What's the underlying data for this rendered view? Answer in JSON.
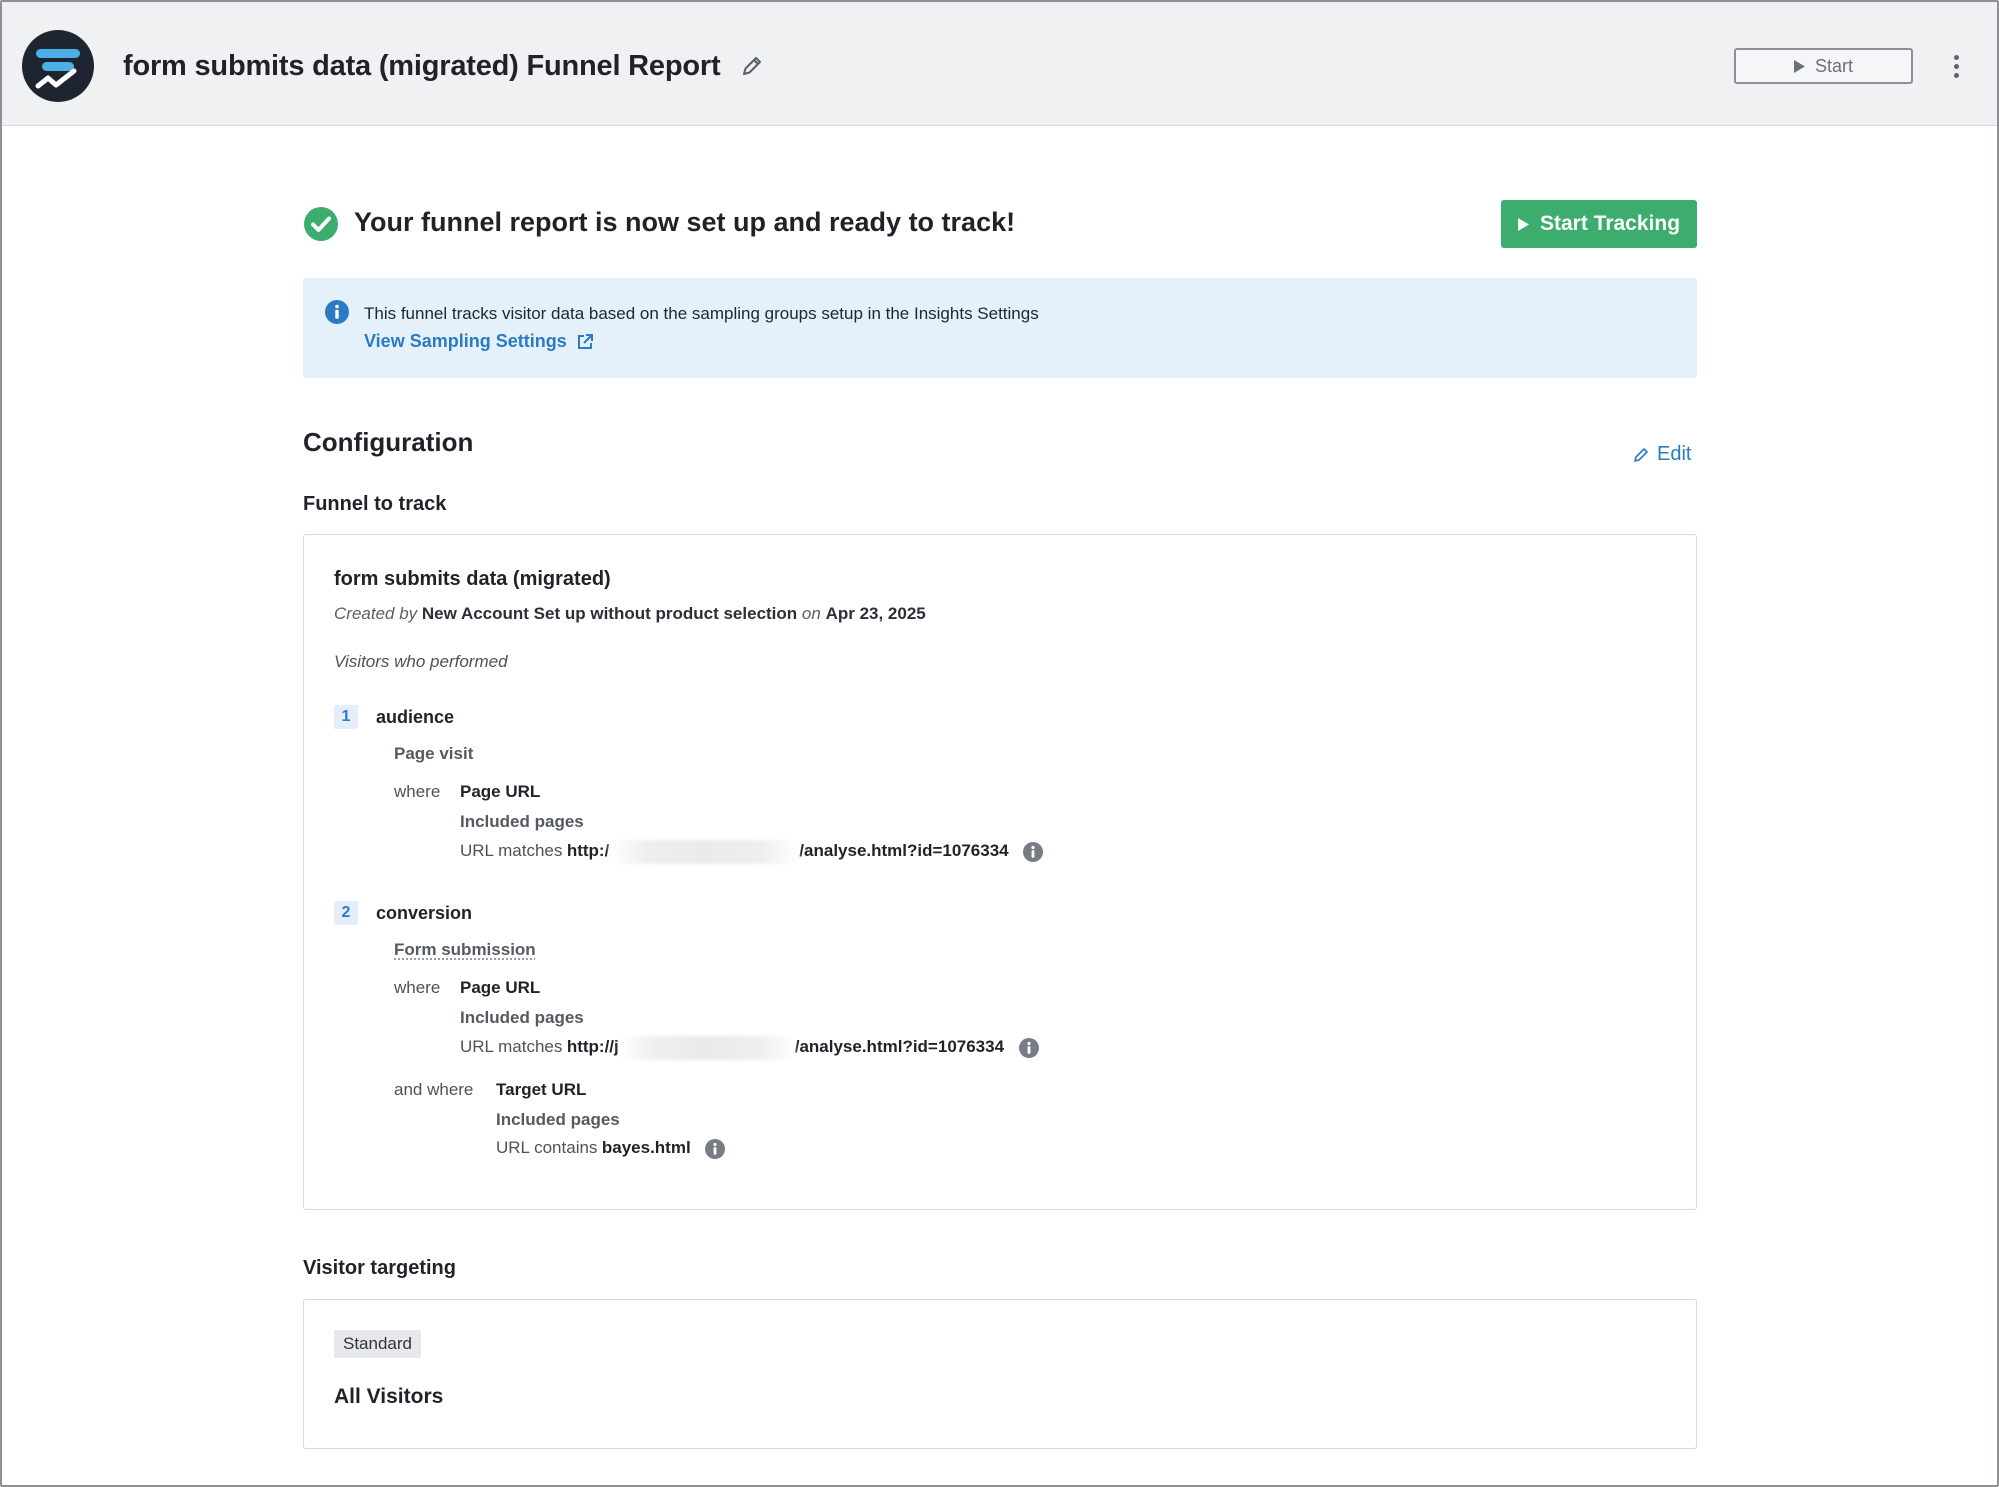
{
  "header": {
    "title": "form submits data (migrated) Funnel Report",
    "start_label": "Start"
  },
  "banner": {
    "title": "Your funnel report is now set up and ready to track!",
    "start_tracking_label": "Start Tracking"
  },
  "info": {
    "text": "This funnel tracks visitor data based on the sampling groups setup in the Insights Settings",
    "link_label": "View Sampling Settings"
  },
  "configuration": {
    "title": "Configuration",
    "edit_label": "Edit",
    "funnel_label": "Funnel to track"
  },
  "funnel": {
    "name": "form submits data (migrated)",
    "created_by_label": "Created by",
    "creator": "New Account Set up without product selection",
    "on_label": "on",
    "date": "Apr 23, 2025",
    "visitors_label": "Visitors who performed",
    "steps": [
      {
        "number": "1",
        "name": "audience",
        "event": "Page visit",
        "where_label": "where",
        "field": "Page URL",
        "included": "Included pages",
        "match_label": "URL matches",
        "url_start": "http:/",
        "url_end": "/analyse.html?id=1076334"
      },
      {
        "number": "2",
        "name": "conversion",
        "event": "Form submission",
        "where_label": "where",
        "field": "Page URL",
        "included": "Included pages",
        "match_label": "URL matches",
        "url_start": "http://j",
        "url_end": "/analyse.html?id=1076334",
        "and_where_label": "and where",
        "field2": "Target URL",
        "included2": "Included pages",
        "match_label2": "URL contains",
        "value2": "bayes.html"
      }
    ]
  },
  "targeting": {
    "title": "Visitor targeting",
    "badge": "Standard",
    "audience": "All Visitors"
  },
  "colors": {
    "success_green": "#3cad6d",
    "link_blue": "#2a7ac4",
    "info_bg": "#e4f1fb"
  }
}
